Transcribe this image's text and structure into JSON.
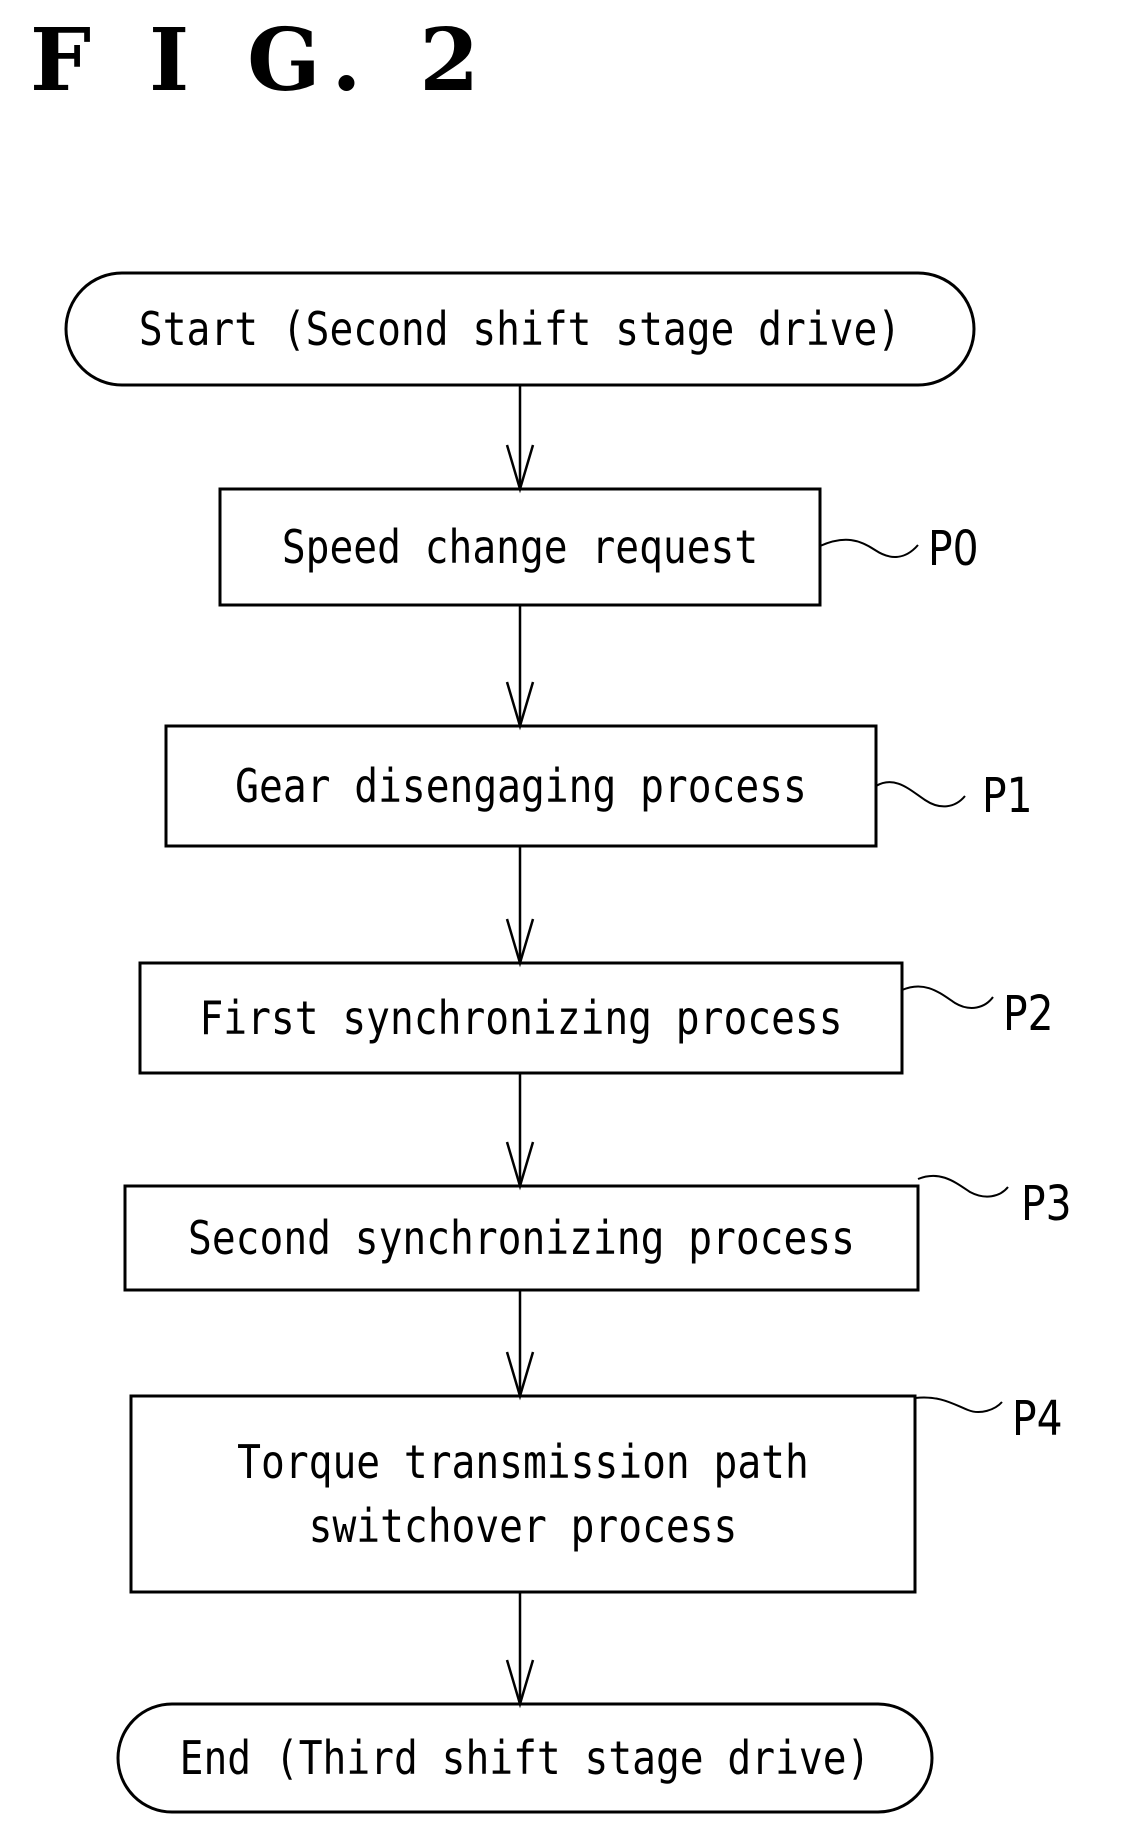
{
  "figure": {
    "title": "F I G. 2"
  },
  "nodes": [
    {
      "id": "start",
      "type": "terminal",
      "text": "Start (Second shift stage drive)",
      "ref": ""
    },
    {
      "id": "p0",
      "type": "process",
      "text": "Speed change request",
      "ref": "P0"
    },
    {
      "id": "p1",
      "type": "process",
      "text": "Gear disengaging process",
      "ref": "P1"
    },
    {
      "id": "p2",
      "type": "process",
      "text": "First synchronizing process",
      "ref": "P2"
    },
    {
      "id": "p3",
      "type": "process",
      "text": "Second synchronizing process",
      "ref": "P3"
    },
    {
      "id": "p4",
      "type": "process",
      "text": "Torque transmission path\nswitchover process",
      "ref": "P4"
    },
    {
      "id": "end",
      "type": "terminal",
      "text": "End (Third shift stage drive)",
      "ref": ""
    }
  ],
  "edges": [
    {
      "from": "start",
      "to": "p0"
    },
    {
      "from": "p0",
      "to": "p1"
    },
    {
      "from": "p1",
      "to": "p2"
    },
    {
      "from": "p2",
      "to": "p3"
    },
    {
      "from": "p3",
      "to": "p4"
    },
    {
      "from": "p4",
      "to": "end"
    }
  ]
}
